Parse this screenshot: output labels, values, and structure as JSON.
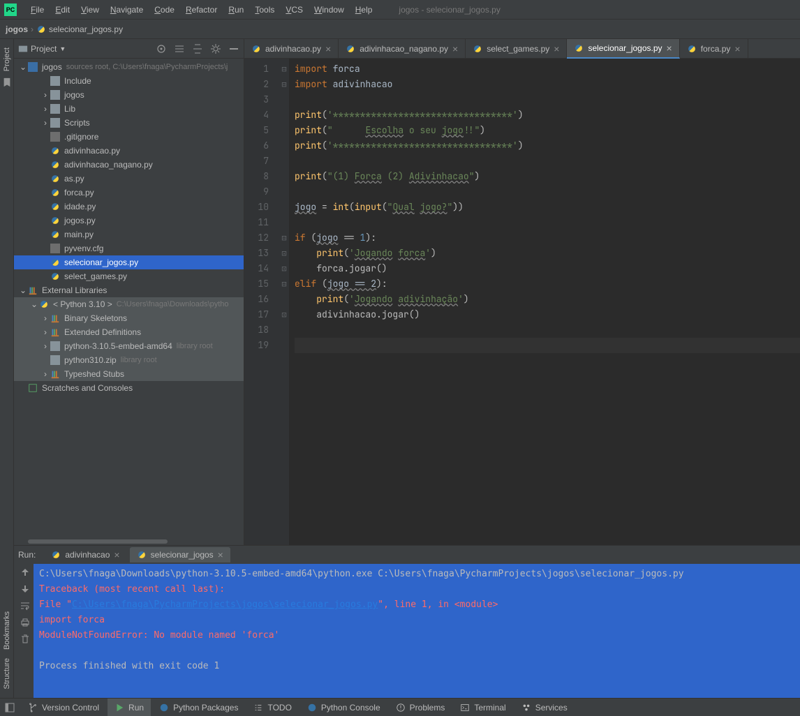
{
  "menu": [
    "File",
    "Edit",
    "View",
    "Navigate",
    "Code",
    "Refactor",
    "Run",
    "Tools",
    "VCS",
    "Window",
    "Help"
  ],
  "title_context": "jogos - selecionar_jogos.py",
  "breadcrumb": {
    "root": "jogos",
    "file": "selecionar_jogos.py"
  },
  "project_panel": {
    "title": "Project",
    "root": {
      "name": "jogos",
      "hint": "sources root,  C:\\Users\\fnaga\\PycharmProjects\\j"
    },
    "root_children": [
      {
        "type": "folder",
        "name": "Include",
        "depth": 2,
        "caret": ""
      },
      {
        "type": "folder",
        "name": "jogos",
        "depth": 2,
        "caret": "›"
      },
      {
        "type": "folder",
        "name": "Lib",
        "depth": 2,
        "caret": "›"
      },
      {
        "type": "folder",
        "name": "Scripts",
        "depth": 2,
        "caret": "›"
      },
      {
        "type": "txt",
        "name": ".gitignore",
        "depth": 2
      },
      {
        "type": "py",
        "name": "adivinhacao.py",
        "depth": 2
      },
      {
        "type": "py",
        "name": "adivinhacao_nagano.py",
        "depth": 2
      },
      {
        "type": "py",
        "name": "as.py",
        "depth": 2
      },
      {
        "type": "py",
        "name": "forca.py",
        "depth": 2
      },
      {
        "type": "py",
        "name": "idade.py",
        "depth": 2
      },
      {
        "type": "py",
        "name": "jogos.py",
        "depth": 2
      },
      {
        "type": "py",
        "name": "main.py",
        "depth": 2
      },
      {
        "type": "txt",
        "name": "pyvenv.cfg",
        "depth": 2
      },
      {
        "type": "py",
        "name": "selecionar_jogos.py",
        "depth": 2,
        "selected": true
      },
      {
        "type": "py",
        "name": "select_games.py",
        "depth": 2
      }
    ],
    "external": {
      "label": "External Libraries",
      "python": "< Python 3.10 >",
      "python_hint": "C:\\Users\\fnaga\\Downloads\\pytho",
      "items": [
        {
          "name": "Binary Skeletons",
          "caret": "›"
        },
        {
          "name": "Extended Definitions",
          "caret": "›"
        },
        {
          "name": "python-3.10.5-embed-amd64",
          "hint": "library root",
          "caret": "›",
          "folder": true
        },
        {
          "name": "python310.zip",
          "hint": "library root",
          "folder": true
        },
        {
          "name": "Typeshed Stubs",
          "caret": "›"
        }
      ]
    },
    "scratches": "Scratches and Consoles"
  },
  "tabs": [
    {
      "name": "adivinhacao.py"
    },
    {
      "name": "adivinhacao_nagano.py"
    },
    {
      "name": "select_games.py"
    },
    {
      "name": "selecionar_jogos.py",
      "active": true
    },
    {
      "name": "forca.py"
    }
  ],
  "code": {
    "line_count": 19,
    "current_line": 19
  },
  "run": {
    "label": "Run:",
    "tabs": [
      {
        "name": "adivinhacao"
      },
      {
        "name": "selecionar_jogos",
        "active": true
      }
    ],
    "console": {
      "cmd": "C:\\Users\\fnaga\\Downloads\\python-3.10.5-embed-amd64\\python.exe C:\\Users\\fnaga\\PycharmProjects\\jogos\\selecionar_jogos.py",
      "trace": "Traceback (most recent call last):",
      "file_prefix": "  File \"",
      "file_link": "C:\\Users\\fnaga\\PycharmProjects\\jogos\\selecionar_jogos.py",
      "file_suffix": "\", line 1, in <module>",
      "import_line": "    import forca",
      "error": "ModuleNotFoundError: No module named 'forca'",
      "exit": "Process finished with exit code 1"
    }
  },
  "status": [
    {
      "icon": "branch",
      "label": "Version Control"
    },
    {
      "icon": "play",
      "label": "Run",
      "active": true
    },
    {
      "icon": "python",
      "label": "Python Packages"
    },
    {
      "icon": "todo",
      "label": "TODO"
    },
    {
      "icon": "python",
      "label": "Python Console"
    },
    {
      "icon": "problems",
      "label": "Problems"
    },
    {
      "icon": "terminal",
      "label": "Terminal"
    },
    {
      "icon": "services",
      "label": "Services"
    }
  ],
  "left_rail": [
    "Project"
  ],
  "bottom_left_rail": [
    "Bookmarks",
    "Structure"
  ]
}
